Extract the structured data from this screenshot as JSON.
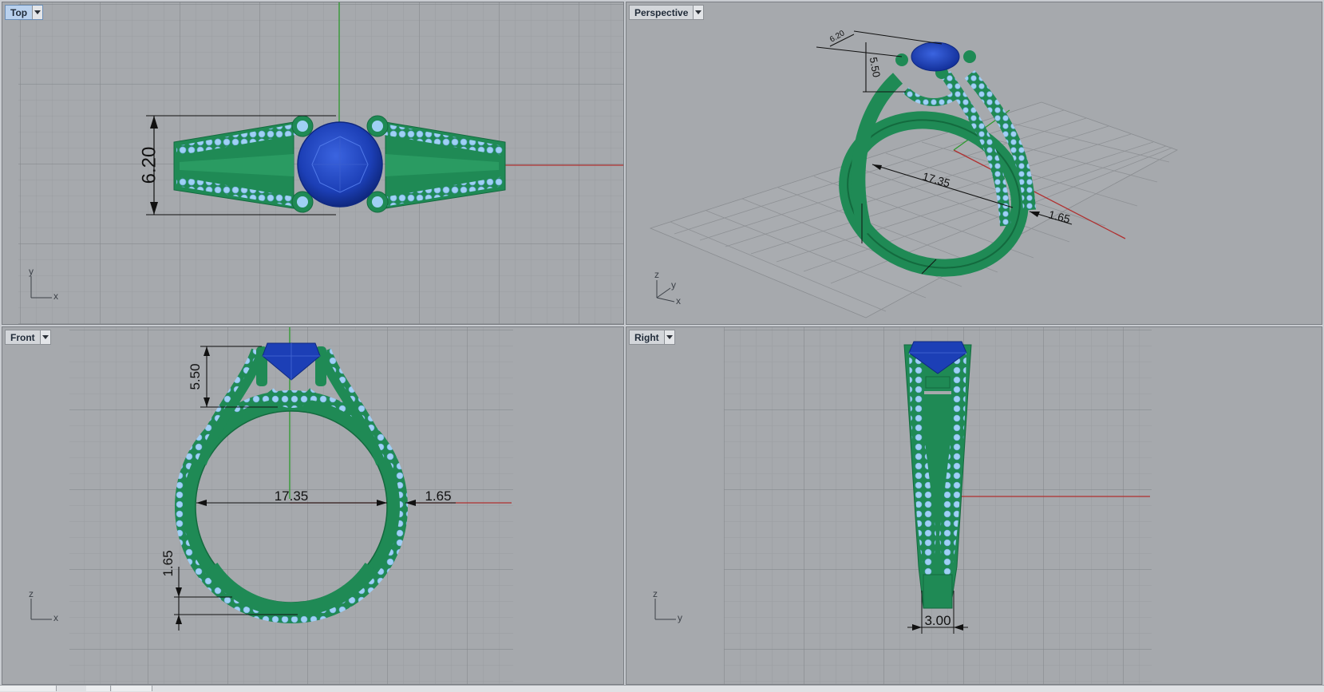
{
  "viewports": {
    "top": {
      "name": "Top",
      "active": true
    },
    "perspective": {
      "name": "Perspective",
      "active": false
    },
    "front": {
      "name": "Front",
      "active": false
    },
    "right": {
      "name": "Right",
      "active": false
    }
  },
  "dimensions": {
    "top_height": "6.20",
    "persp_head": "6.20",
    "persp_height": "5.50",
    "persp_inner": "17.35",
    "persp_band": "1.65",
    "front_head": "5.50",
    "front_inner": "17.35",
    "front_band_side": "1.65",
    "front_band_bottom": "1.65",
    "right_width": "3.00"
  },
  "axes": {
    "top": {
      "v": "y",
      "h": "x"
    },
    "perspective": {
      "v": "z",
      "d": "y",
      "h": "x"
    },
    "front": {
      "v": "z",
      "h": "x"
    },
    "right": {
      "v": "z",
      "h": "y"
    }
  },
  "colors": {
    "viewport_bg": "#a6a9ad",
    "grid_minor": "#9a9da1",
    "grid_major": "#8b8e92",
    "ring_metal": "#1f8a55",
    "ring_metal_dark": "#136a3e",
    "pave_stones": "#9fd0f5",
    "center_stone": "#1c3fb6",
    "x_axis": "#b03030",
    "y_axis": "#2d9a2d"
  }
}
